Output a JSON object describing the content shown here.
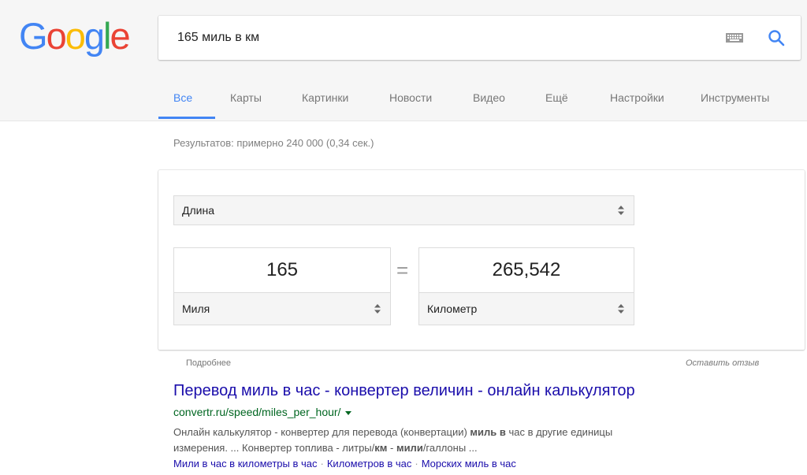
{
  "logo": {
    "letters": [
      "G",
      "o",
      "o",
      "g",
      "l",
      "e"
    ],
    "colors": [
      "#4285F4",
      "#EA4335",
      "#FBBC05",
      "#4285F4",
      "#34A853",
      "#EA4335"
    ]
  },
  "search": {
    "query": "165 миль в км"
  },
  "tabs": [
    {
      "label": "Все",
      "active": true
    },
    {
      "label": "Карты",
      "active": false
    },
    {
      "label": "Картинки",
      "active": false
    },
    {
      "label": "Новости",
      "active": false
    },
    {
      "label": "Видео",
      "active": false
    },
    {
      "label": "Ещё",
      "active": false
    },
    {
      "label": "Настройки",
      "active": false
    },
    {
      "label": "Инструменты",
      "active": false
    }
  ],
  "result_stats": "Результатов: примерно 240 000 (0,34 сек.)",
  "converter": {
    "category": "Длина",
    "from_value": "165",
    "from_unit": "Миля",
    "equals": "=",
    "to_value": "265,542",
    "to_unit": "Километр",
    "more_label": "Подробнее",
    "feedback_label": "Оставить отзыв"
  },
  "result": {
    "title": "Перевод миль в час - конвертер величин - онлайн калькулятор",
    "url": "convertr.ru/speed/miles_per_hour/",
    "snippet_line1_pre": "Онлайн калькулятор - конвертер для перевода (конвертации) ",
    "snippet_line1_bold": "миль в",
    "snippet_line1_post": " час в другие единицы",
    "snippet_line2_pre": "измерения. ... Конвертер топлива - литры/",
    "snippet_line2_bold1": "км",
    "snippet_line2_mid": " - ",
    "snippet_line2_bold2": "мили",
    "snippet_line2_post": "/галлоны ...",
    "sitelinks": [
      "Мили в час в километры в час",
      "Километров в час",
      "Морских миль в час"
    ],
    "sitelink_separator": "·"
  },
  "colors": {
    "accent": "#4285f4",
    "link": "#1a0dab",
    "url": "#006621"
  }
}
